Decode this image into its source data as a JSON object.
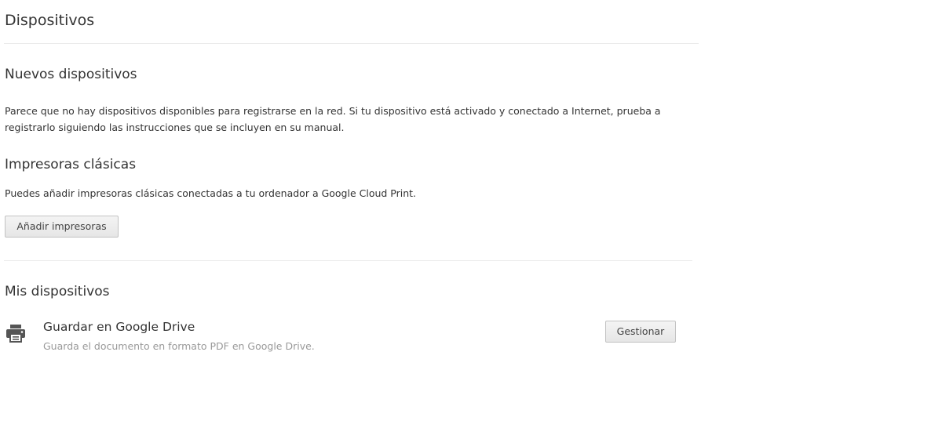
{
  "header": {
    "title": "Dispositivos"
  },
  "new_devices": {
    "title": "Nuevos dispositivos",
    "description_line1": "Parece que no hay dispositivos disponibles para registrarse en la red. Si tu dispositivo está activado y conectado a Internet, prueba a",
    "description_line2": "registrarlo siguiendo las instrucciones que se incluyen en su manual."
  },
  "classic_printers": {
    "title": "Impresoras clásicas",
    "description": "Puedes añadir impresoras clásicas conectadas a tu ordenador a Google Cloud Print.",
    "add_button_label": "Añadir impresoras"
  },
  "my_devices": {
    "title": "Mis dispositivos",
    "items": [
      {
        "icon": "printer-icon",
        "name": "Guardar en Google Drive",
        "description": "Guarda el documento en formato PDF en Google Drive.",
        "manage_label": "Gestionar"
      }
    ]
  },
  "colors": {
    "text": "#333333",
    "muted_text": "#999999",
    "divider": "#ebebeb",
    "icon": "#555555"
  }
}
